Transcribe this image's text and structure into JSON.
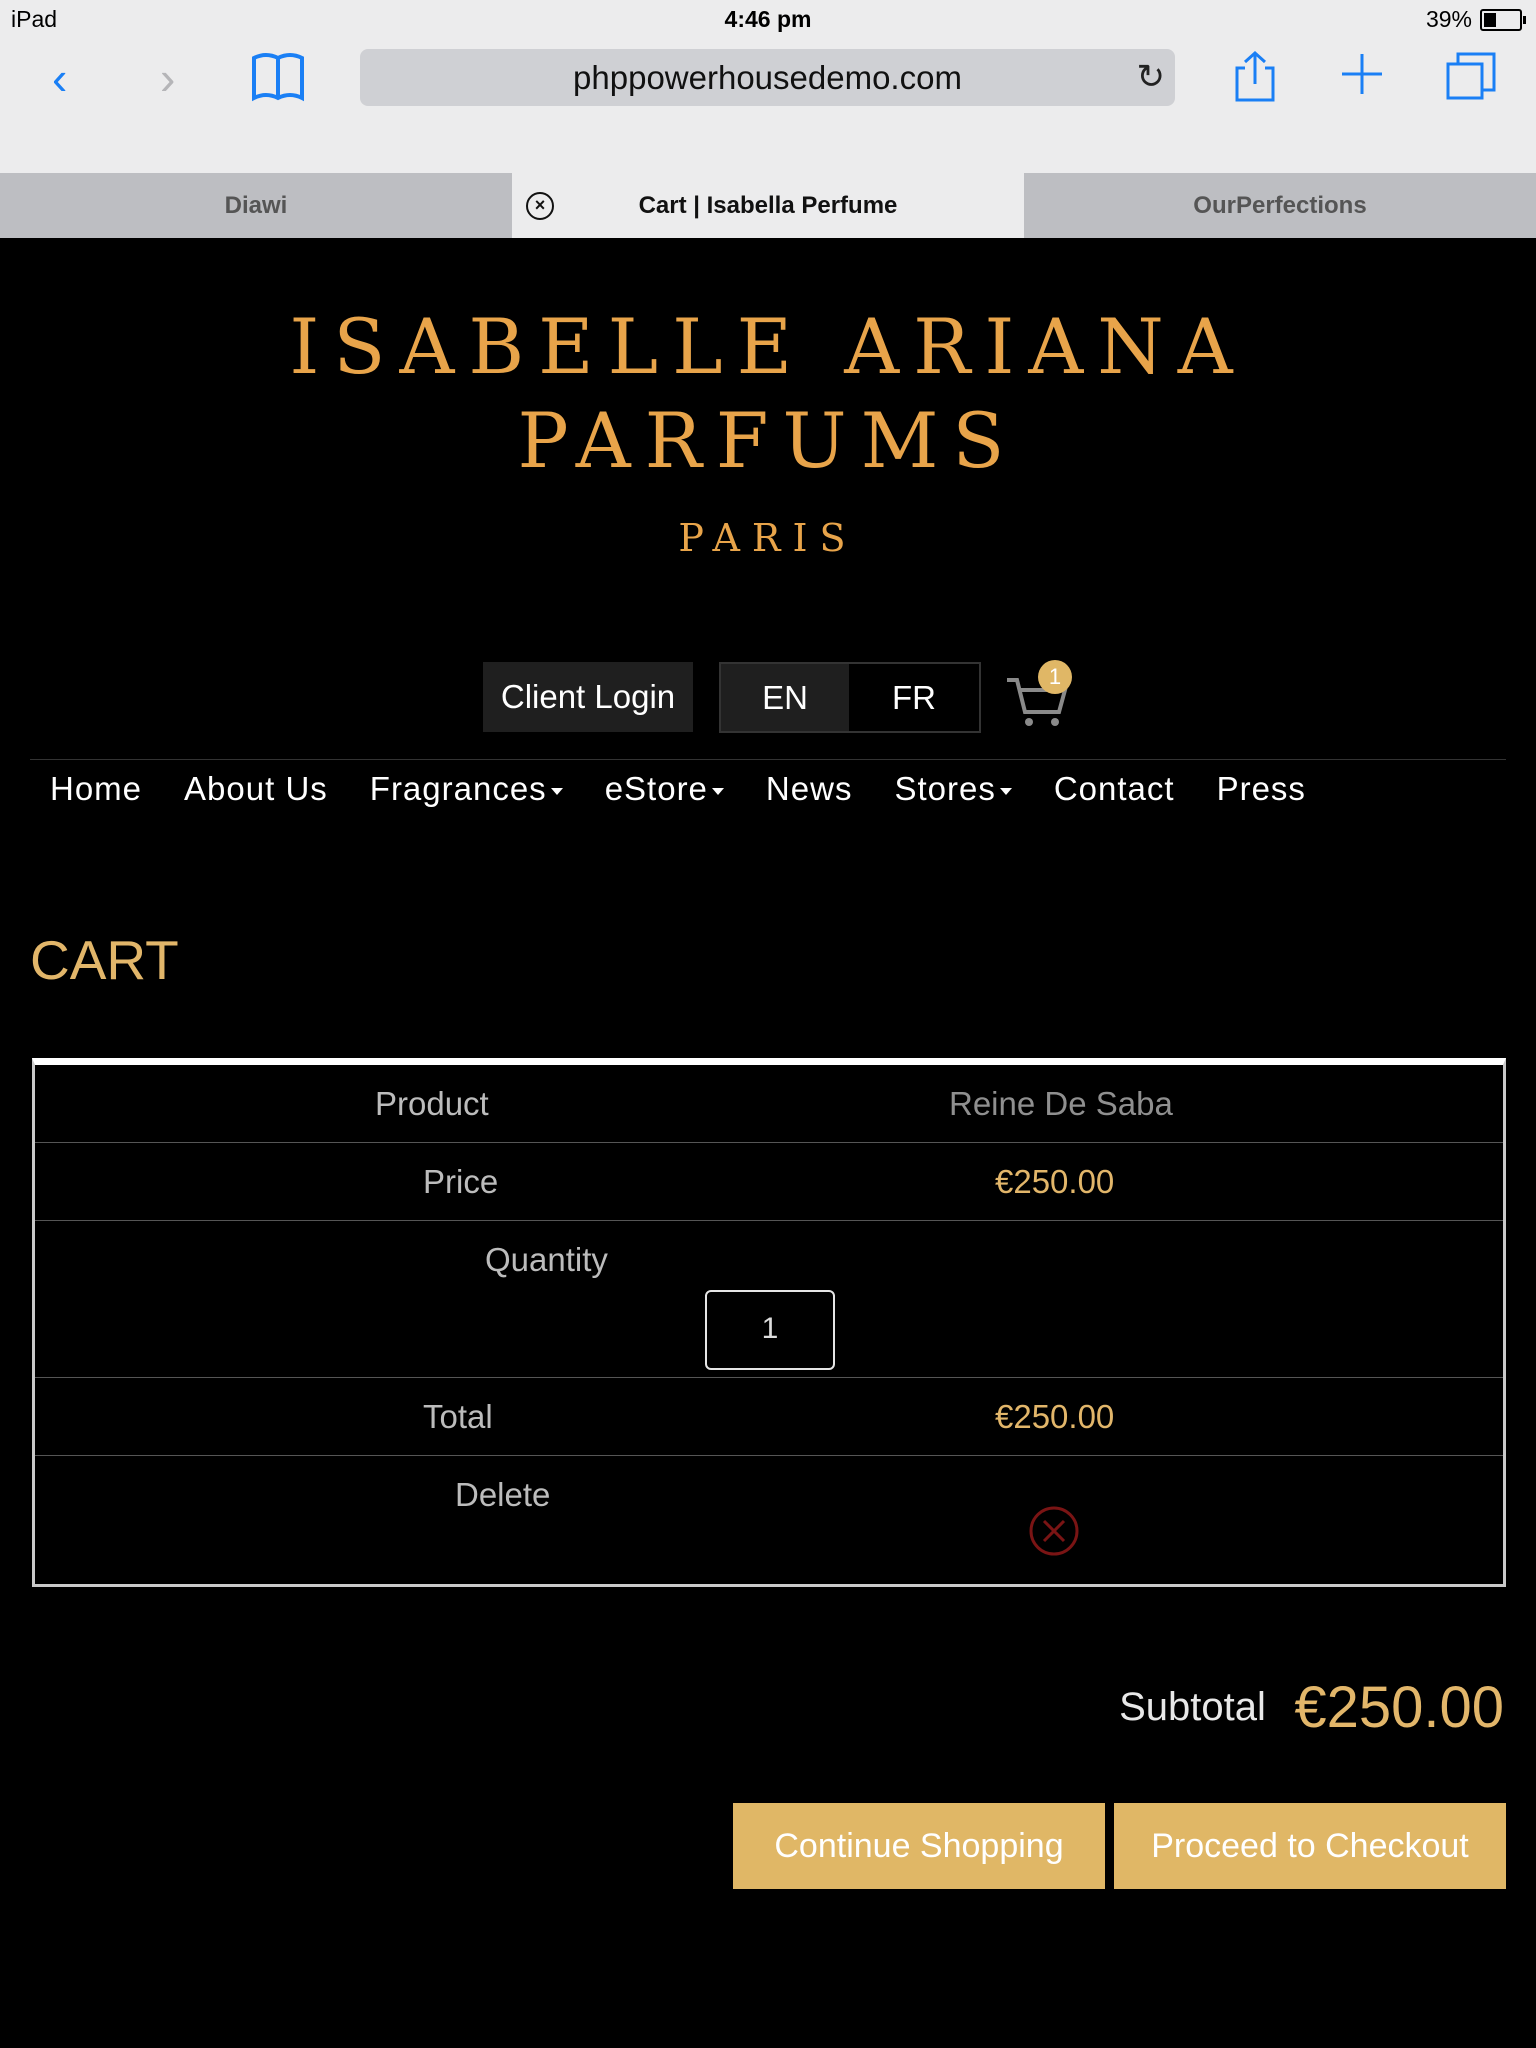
{
  "status": {
    "device": "iPad",
    "time": "4:46 pm",
    "battery": "39%"
  },
  "browser": {
    "url": "phppowerhousedemo.com",
    "tabs": [
      {
        "label": "Diawi"
      },
      {
        "label": "Cart | Isabella Perfume"
      },
      {
        "label": "OurPerfections"
      }
    ]
  },
  "brand": {
    "line1": "ISABELLE ARIANA",
    "line2": "PARFUMS",
    "line3": "PARIS"
  },
  "toolbar": {
    "login": "Client Login",
    "lang_en": "EN",
    "lang_fr": "FR",
    "cart_count": "1"
  },
  "nav": [
    {
      "label": "Home"
    },
    {
      "label": "About Us"
    },
    {
      "label": "Fragrances"
    },
    {
      "label": "eStore"
    },
    {
      "label": "News"
    },
    {
      "label": "Stores"
    },
    {
      "label": "Contact"
    },
    {
      "label": "Press"
    }
  ],
  "cart": {
    "title": "CART",
    "product_label": "Product",
    "product_value": "Reine De Saba",
    "price_label": "Price",
    "price_value": "€250.00",
    "quantity_label": "Quantity",
    "quantity_value": "1",
    "total_label": "Total",
    "total_value": "€250.00",
    "delete_label": "Delete"
  },
  "summary": {
    "subtotal_label": "Subtotal",
    "subtotal_value": "€250.00",
    "continue": "Continue Shopping",
    "checkout": "Proceed to Checkout"
  },
  "colors": {
    "gold": "#e2b66a",
    "button_gold": "#e0b766",
    "link_blue": "#1a7ff5",
    "delete_red": "#7a1414"
  }
}
